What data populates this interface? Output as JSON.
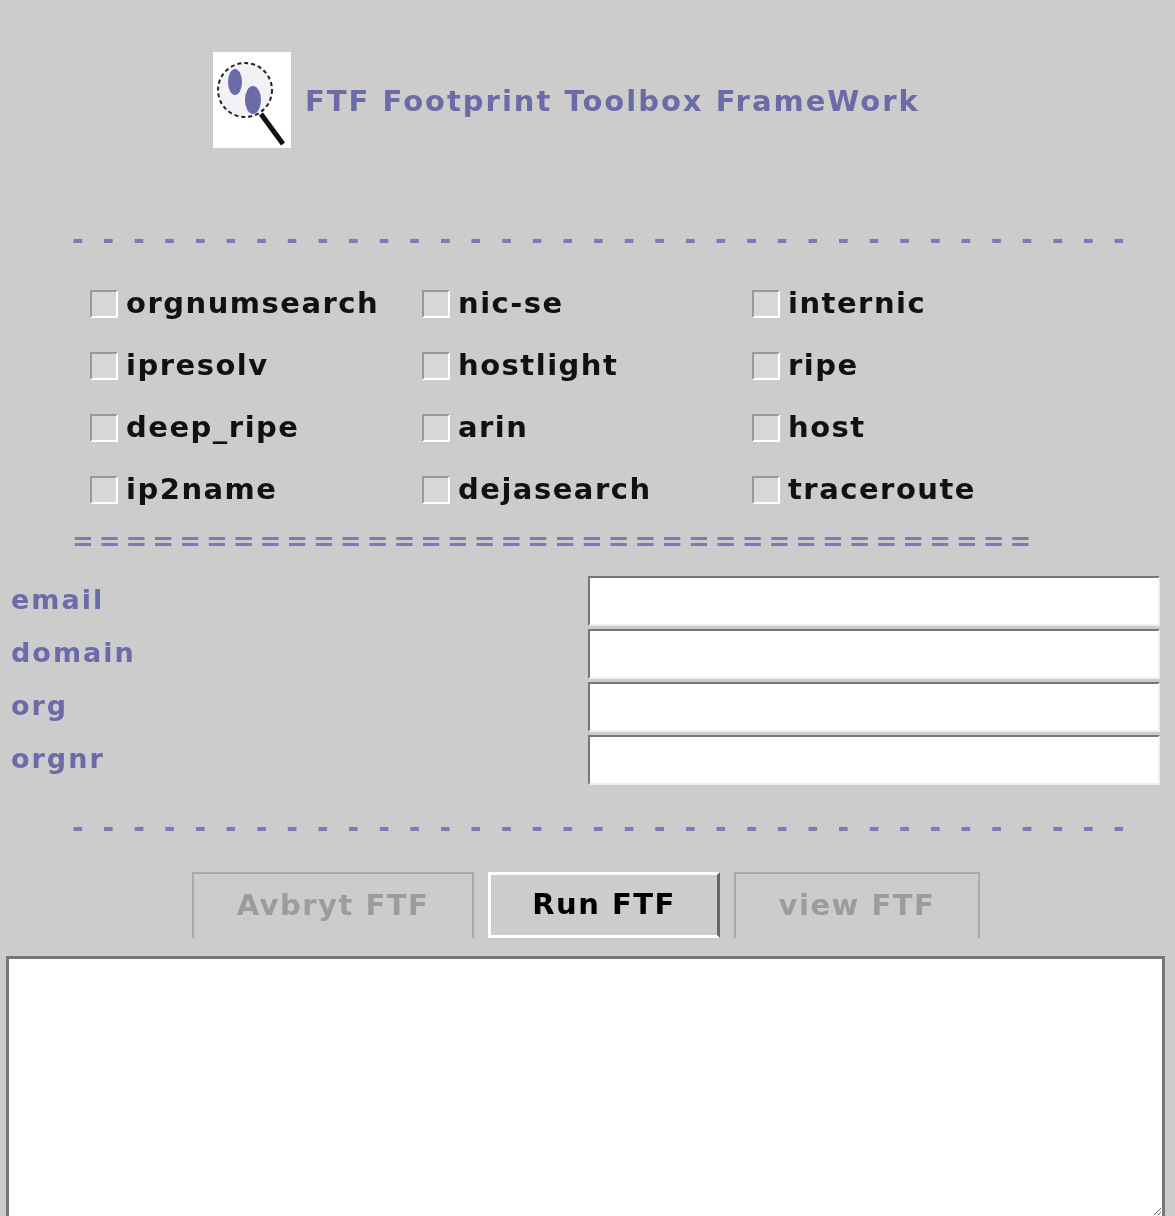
{
  "header": {
    "title": "FTF Footprint Toolbox FrameWork"
  },
  "separator_top": "-----------------------------------",
  "options": [
    {
      "label": "orgnumsearch",
      "checked": false
    },
    {
      "label": "nic-se",
      "checked": false
    },
    {
      "label": "internic",
      "checked": false
    },
    {
      "label": "ipresolv",
      "checked": false
    },
    {
      "label": "hostlight",
      "checked": false
    },
    {
      "label": "ripe",
      "checked": false
    },
    {
      "label": "deep_ripe",
      "checked": false
    },
    {
      "label": "arin",
      "checked": false
    },
    {
      "label": "host",
      "checked": false
    },
    {
      "label": "ip2name",
      "checked": false
    },
    {
      "label": "dejasearch",
      "checked": false
    },
    {
      "label": "traceroute",
      "checked": false
    }
  ],
  "separator_middle": "====================================",
  "fields": [
    {
      "label": "email"
    },
    {
      "label": "domain"
    },
    {
      "label": "org"
    },
    {
      "label": "orgnr"
    }
  ],
  "separator_bottom": "-----------------------------------",
  "buttons": [
    {
      "label": "Avbryt FTF",
      "disabled": true
    },
    {
      "label": "Run FTF",
      "disabled": false
    },
    {
      "label": "view FTF",
      "disabled": true
    }
  ],
  "output": {
    "kind": "text-area"
  }
}
